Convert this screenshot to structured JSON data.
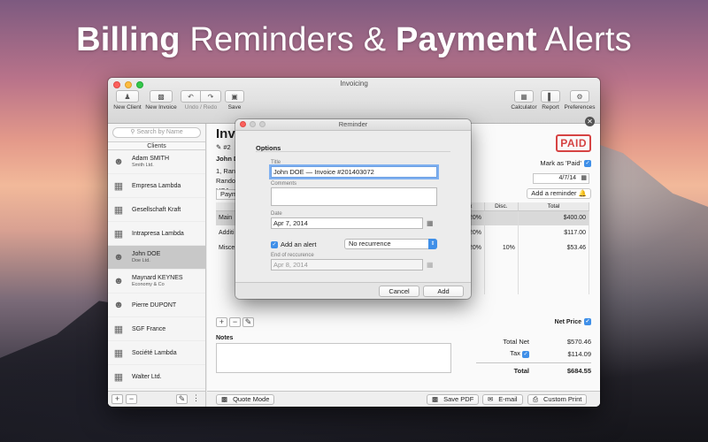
{
  "headline": {
    "part1": "Billing",
    "part2": "Reminders &",
    "part3": "Payment",
    "part4": "Alerts"
  },
  "window": {
    "title": "Invoicing"
  },
  "toolbar": {
    "new_client": "New Client",
    "new_invoice": "New Invoice",
    "undo_redo": "Undo / Redo",
    "save": "Save",
    "calculator": "Calculator",
    "report": "Report",
    "preferences": "Preferences"
  },
  "sidebar": {
    "search_placeholder": "Search by Name",
    "header": "Clients",
    "clients": [
      {
        "name": "Adam SMITH",
        "company": "Smith Ltd.",
        "icon": "person-icon"
      },
      {
        "name": "Empresa Lambda",
        "company": "",
        "icon": "building-icon"
      },
      {
        "name": "Gesellschaft Kraft",
        "company": "",
        "icon": "building-icon"
      },
      {
        "name": "Intrapresa Lambda",
        "company": "",
        "icon": "building-icon"
      },
      {
        "name": "John DOE",
        "company": "Doe Ltd.",
        "icon": "person-icon",
        "selected": true
      },
      {
        "name": "Maynard KEYNES",
        "company": "Economy & Co",
        "icon": "person-icon"
      },
      {
        "name": "Pierre DUPONT",
        "company": "",
        "icon": "person-icon"
      },
      {
        "name": "SGF France",
        "company": "",
        "icon": "building-icon"
      },
      {
        "name": "Société Lambda",
        "company": "",
        "icon": "building-icon"
      },
      {
        "name": "Walter Ltd.",
        "company": "",
        "icon": "building-icon"
      }
    ],
    "add_label": "+",
    "remove_label": "−"
  },
  "invoice": {
    "title": "Inv",
    "number_prefix": "#2",
    "client_name": "John D",
    "address_line1": "1, Ran",
    "address_line2": "Rando",
    "address_line3": "USA",
    "paid_stamp": "PAID",
    "mark_paid_label": "Mark as 'Paid'",
    "date": "4/7/14",
    "add_reminder": "Add a reminder",
    "payment_label": "Paym",
    "columns": [
      "",
      "",
      "",
      "",
      "Tax",
      "Disc.",
      "Total"
    ],
    "rows": [
      {
        "desc": "Main",
        "tax": "20%",
        "disc": "",
        "total": "$400.00"
      },
      {
        "desc": "Additi",
        "tax": "20%",
        "disc": "",
        "total": "$117.00"
      },
      {
        "desc": "Misce",
        "tax": "20%",
        "disc": "10%",
        "total": "$53.46"
      }
    ],
    "net_price_label": "Net Price",
    "notes_label": "Notes",
    "total_net_label": "Total Net",
    "total_net": "$570.46",
    "tax_label": "Tax",
    "tax_value": "$114.09",
    "total_label": "Total",
    "total_value": "$684.55"
  },
  "bottom_bar": {
    "quote_mode": "Quote Mode",
    "save_pdf": "Save PDF",
    "email": "E-mail",
    "custom_print": "Custom Print"
  },
  "dialog": {
    "title": "Reminder",
    "section": "Options",
    "title_label": "Title",
    "title_value": "John DOE — Invoice #201403072",
    "comments_label": "Comments",
    "comments_value": "",
    "date_label": "Date",
    "date_value": "Apr 7, 2014",
    "add_alert_label": "Add an alert",
    "recurrence_value": "No recurrence",
    "end_label": "End of reccurence",
    "end_value": "Apr 8, 2014",
    "cancel": "Cancel",
    "add": "Add"
  },
  "colors": {
    "accent": "#3f8fe8",
    "paid_red": "#d64343"
  }
}
